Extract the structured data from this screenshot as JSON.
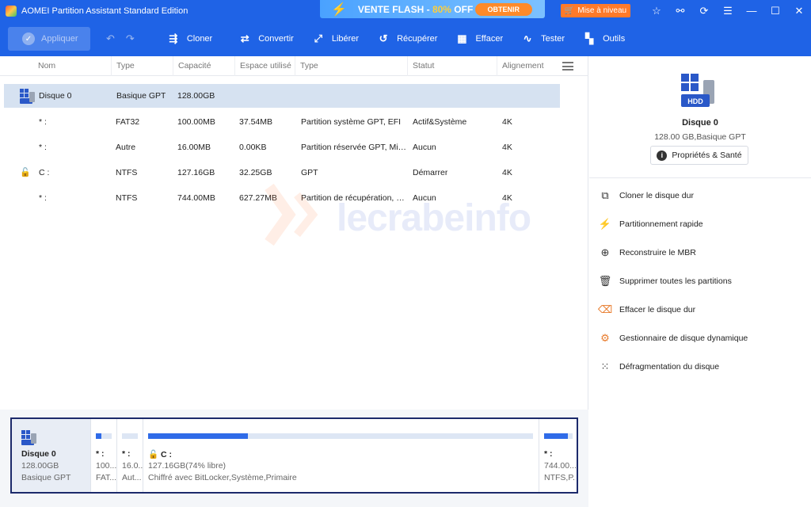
{
  "window": {
    "title": "AOMEI Partition Assistant Standard Edition",
    "promo_text": "VENTE FLASH - ",
    "promo_pct": "80%",
    "promo_off": " OFF",
    "promo_button": "OBTENIR",
    "upgrade": "Mise à niveau"
  },
  "toolbar": {
    "apply": "Appliquer",
    "tools": [
      {
        "label": "Cloner",
        "icon": "clone-icon"
      },
      {
        "label": "Convertir",
        "icon": "convert-icon"
      },
      {
        "label": "Libérer",
        "icon": "free-up-icon"
      },
      {
        "label": "Récupérer",
        "icon": "recover-icon"
      },
      {
        "label": "Effacer",
        "icon": "wipe-icon"
      },
      {
        "label": "Tester",
        "icon": "test-icon"
      },
      {
        "label": "Outils",
        "icon": "tools-icon"
      }
    ]
  },
  "table": {
    "headers": [
      "Nom",
      "Type",
      "Capacité",
      "Espace utilisé",
      "Type",
      "Statut",
      "Alignement"
    ],
    "rows": [
      {
        "name": "Disque 0",
        "type": "Basique GPT",
        "capacity": "128.00GB",
        "used": "",
        "fs": "",
        "status": "",
        "align": ""
      },
      {
        "name": "* :",
        "type": "FAT32",
        "capacity": "100.00MB",
        "used": "37.54MB",
        "fs": "Partition système GPT, EFI",
        "status": "Actif&Système",
        "align": "4K"
      },
      {
        "name": "* :",
        "type": "Autre",
        "capacity": "16.00MB",
        "used": "0.00KB",
        "fs": "Partition réservée GPT, Mi…",
        "status": "Aucun",
        "align": "4K"
      },
      {
        "name": "C :",
        "type": "NTFS",
        "capacity": "127.16GB",
        "used": "32.25GB",
        "fs": "GPT",
        "status": "Démarrer",
        "align": "4K"
      },
      {
        "name": "* :",
        "type": "NTFS",
        "capacity": "744.00MB",
        "used": "627.27MB",
        "fs": "Partition de récupération, …",
        "status": "Aucun",
        "align": "4K"
      }
    ]
  },
  "watermark": "lecrabeinfo",
  "right_panel": {
    "disk_badge": "HDD",
    "disk_name": "Disque 0",
    "disk_sub": "128.00 GB,Basique GPT",
    "properties": "Propriétés & Santé",
    "actions": [
      {
        "label": "Cloner le disque dur",
        "icon": "clone-disk-icon"
      },
      {
        "label": "Partitionnement rapide",
        "icon": "quick-partition-icon"
      },
      {
        "label": "Reconstruire le MBR",
        "icon": "rebuild-mbr-icon"
      },
      {
        "label": "Supprimer toutes les partitions",
        "icon": "trash-icon"
      },
      {
        "label": "Effacer le disque dur",
        "icon": "eraser-icon"
      },
      {
        "label": "Gestionnaire de disque dynamique",
        "icon": "dynamic-disk-icon"
      },
      {
        "label": "Défragmentation du disque",
        "icon": "defrag-icon"
      }
    ]
  },
  "diskmap": {
    "disk": {
      "name": "Disque 0",
      "size": "128.00GB",
      "type": "Basique GPT"
    },
    "partitions": [
      {
        "l1": "* :",
        "l2": "100....",
        "l3": "FAT...",
        "fill": 0.37
      },
      {
        "l1": "* :",
        "l2": "16.0...",
        "l3": "Aut...",
        "fill": 0.0
      },
      {
        "l1": "C :",
        "l2": "127.16GB(74% libre)",
        "l3": "Chiffré avec BitLocker,Système,Primaire",
        "fill": 0.26
      },
      {
        "l1": "* :",
        "l2": "744.00...",
        "l3": "NTFS,P...",
        "fill": 0.84
      }
    ]
  },
  "colors": {
    "accent": "#1f63e6",
    "selected_row": "#d6e2f1",
    "bar_fill": "#2f6be8"
  }
}
